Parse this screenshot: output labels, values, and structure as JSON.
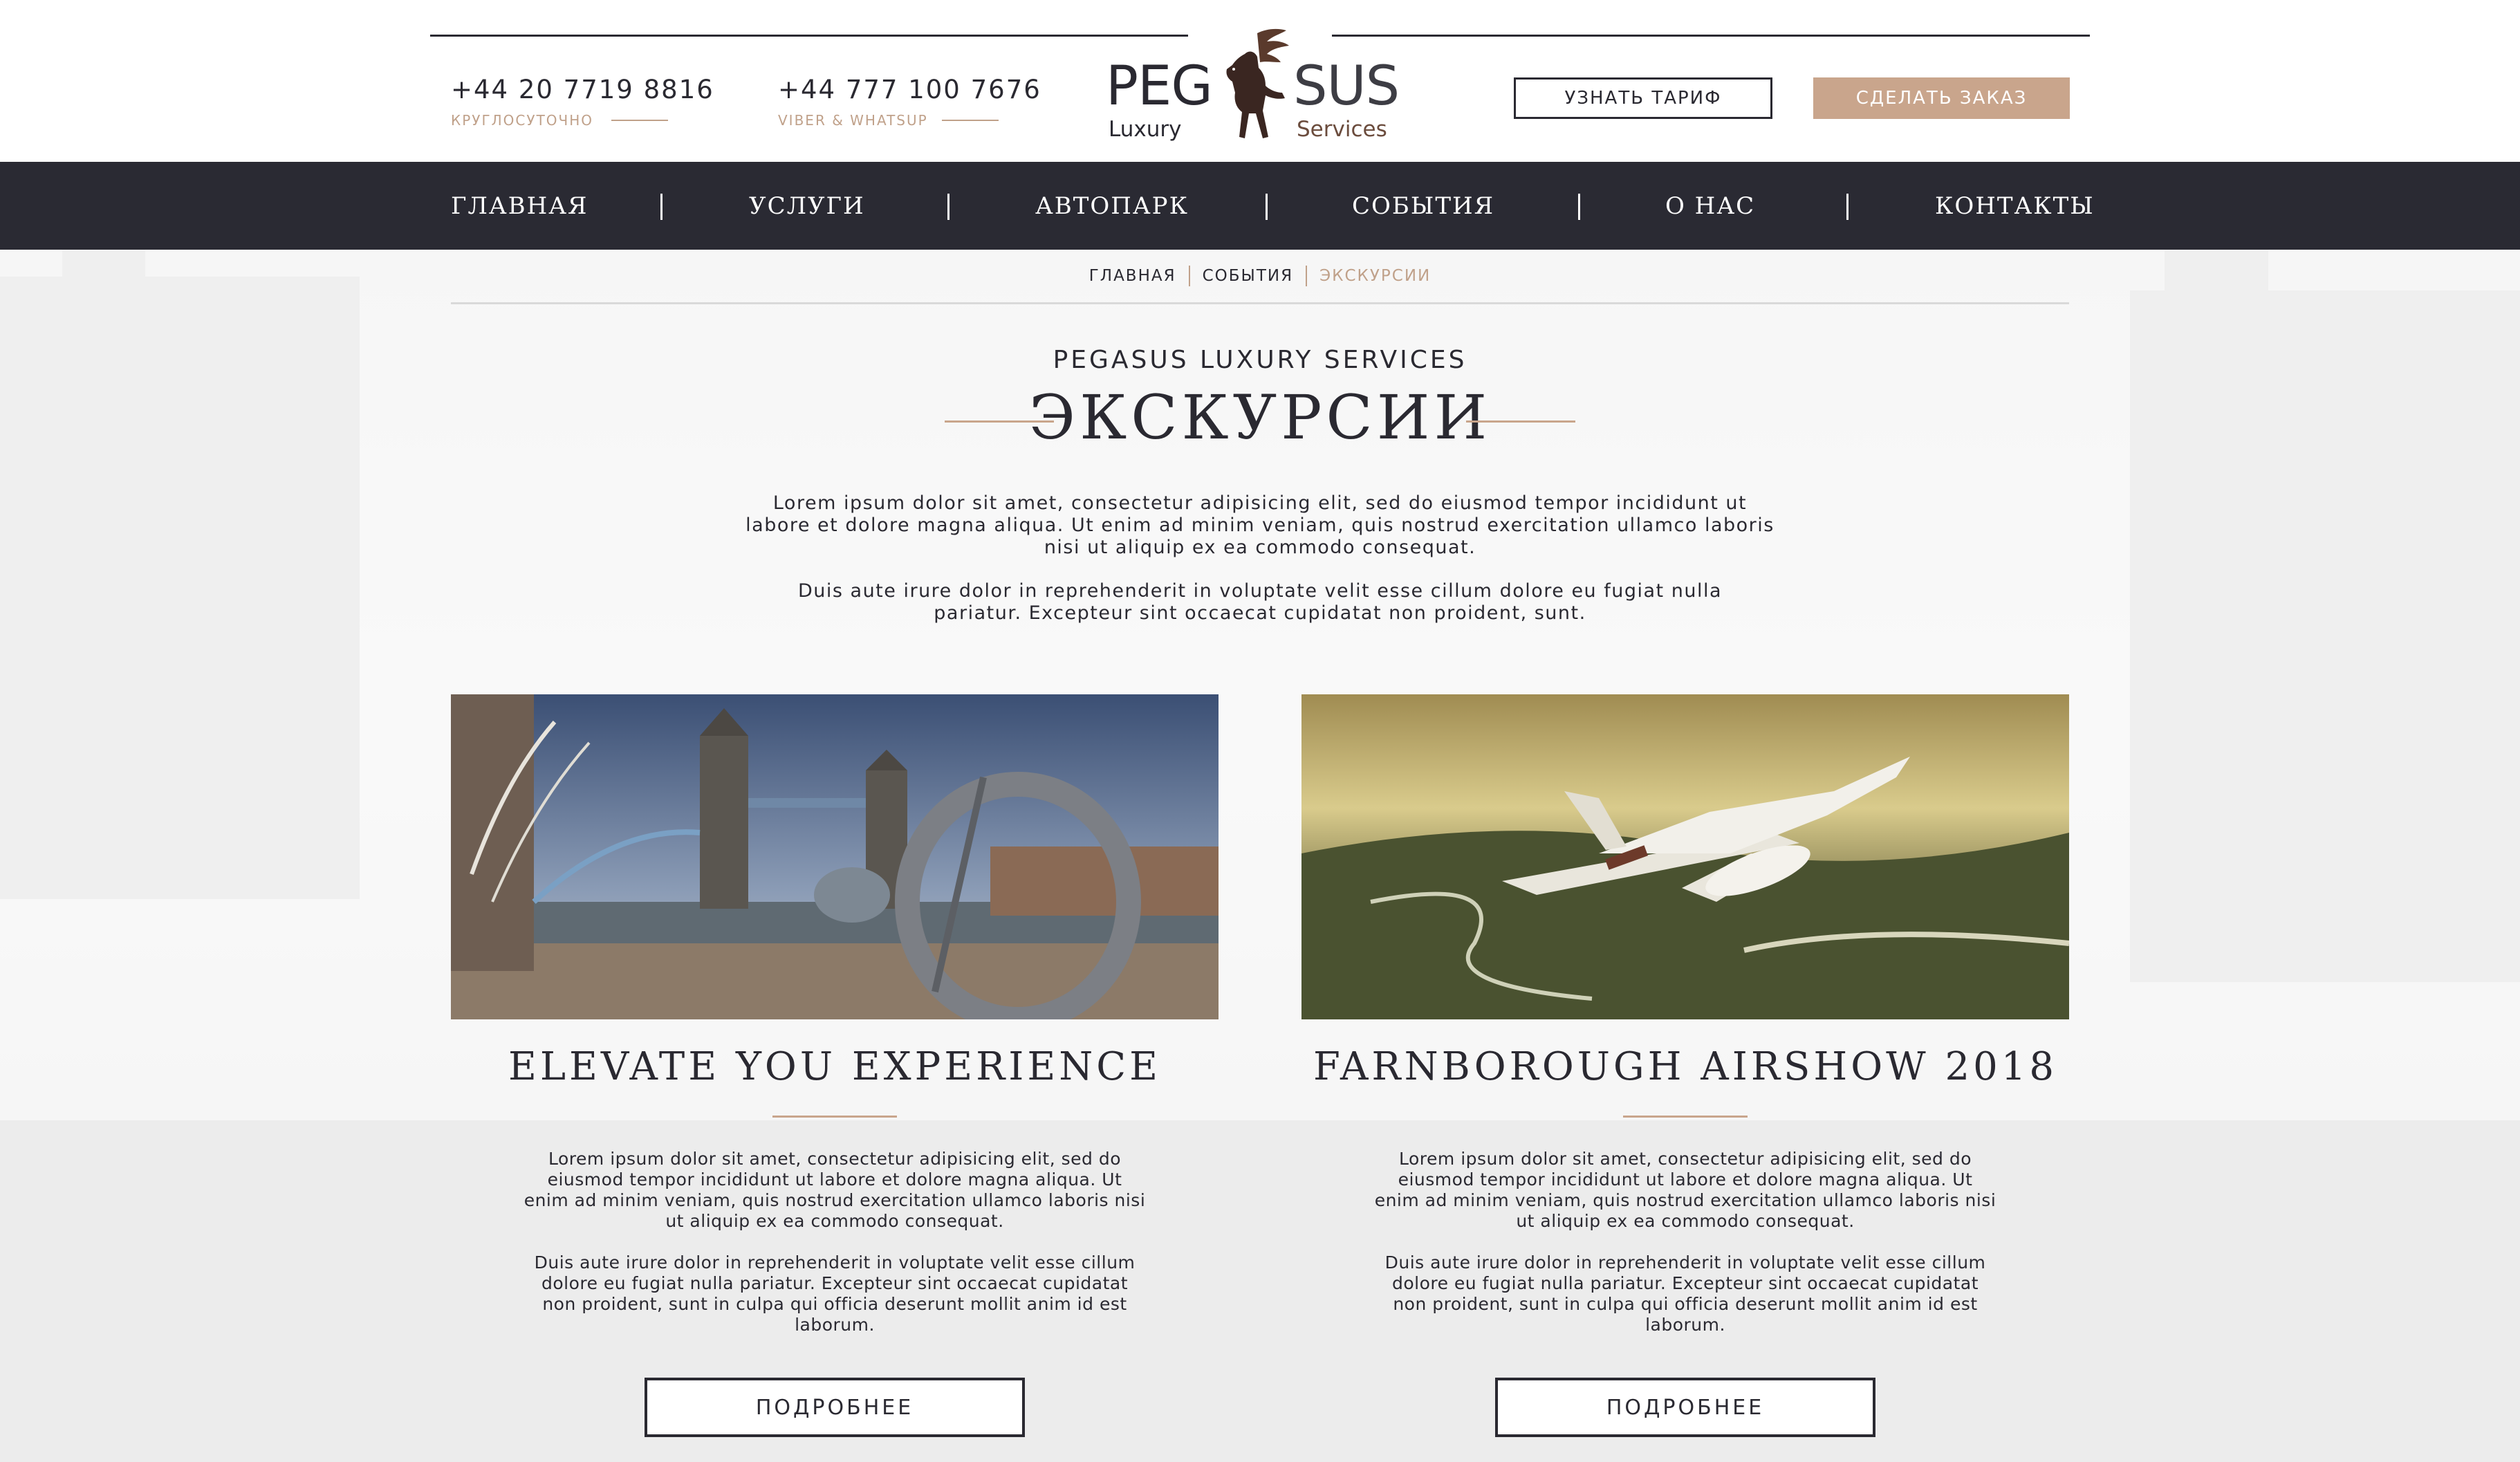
{
  "header": {
    "phone_1": {
      "number": "+44 20 7719 8816",
      "caption": "КРУГЛОСУТОЧНО"
    },
    "phone_2": {
      "number": "+44 777 100 7676",
      "caption": "VIBER & WHATSUP"
    },
    "logo": {
      "word_left": "PEG",
      "word_right": "SUS",
      "sub_left": "Luxury",
      "sub_right": "Services",
      "emblem": "pegasus-horse-icon"
    },
    "tariff_button": "УЗНАТЬ ТАРИФ",
    "order_button": "СДЕЛАТЬ ЗАКАЗ"
  },
  "nav": {
    "items": [
      "ГЛАВНАЯ",
      "УСЛУГИ",
      "АВТОПАРК",
      "СОБЫТИЯ",
      "О НАС",
      "КОНТАКТЫ"
    ]
  },
  "breadcrumb": {
    "items": [
      "ГЛАВНАЯ",
      "СОБЫТИЯ",
      "ЭКСКУРСИИ"
    ]
  },
  "page": {
    "eyebrow": "PEGASUS LUXURY SERVICES",
    "title": "ЭКСКУРСИИ",
    "intro_1": "Lorem ipsum dolor sit amet, consectetur adipisicing elit, sed do eiusmod tempor incididunt ut labore et dolore magna aliqua. Ut enim ad minim veniam, quis nostrud exercitation ullamco laboris nisi ut aliquip ex ea commodo consequat.",
    "intro_2": "Duis aute irure dolor in reprehenderit in voluptate velit esse cillum dolore eu fugiat nulla pariatur. Excepteur sint occaecat cupidatat non proident, sunt."
  },
  "cards": [
    {
      "title": "ELEVATE YOU EXPERIENCE",
      "text_1": "Lorem ipsum dolor sit amet, consectetur adipisicing elit, sed do eiusmod tempor incididunt ut labore et dolore magna aliqua. Ut enim ad minim veniam, quis nostrud exercitation ullamco laboris nisi ut aliquip ex ea commodo consequat.",
      "text_2": "Duis aute irure dolor in reprehenderit in voluptate velit esse cillum dolore eu fugiat nulla pariatur. Excepteur sint occaecat cupidatat non proident, sunt in culpa qui officia deserunt mollit anim id est laborum.",
      "button": "ПОДРОБНЕЕ"
    },
    {
      "title": "FARNBOROUGH AIRSHOW 2018",
      "text_1": "Lorem ipsum dolor sit amet, consectetur adipisicing elit, sed do eiusmod tempor incididunt ut labore et dolore magna aliqua. Ut enim ad minim veniam, quis nostrud exercitation ullamco laboris nisi ut aliquip ex ea commodo consequat.",
      "text_2": "Duis aute irure dolor in reprehenderit in voluptate velit esse cillum dolore eu fugiat nulla pariatur. Excepteur sint occaecat cupidatat non proident, sunt in culpa qui officia deserunt mollit anim id est laborum.",
      "button": "ПОДРОБНЕЕ"
    }
  ],
  "colors": {
    "dark": "#2a2a33",
    "accent": "#c9a58c",
    "text": "#2a2931"
  }
}
